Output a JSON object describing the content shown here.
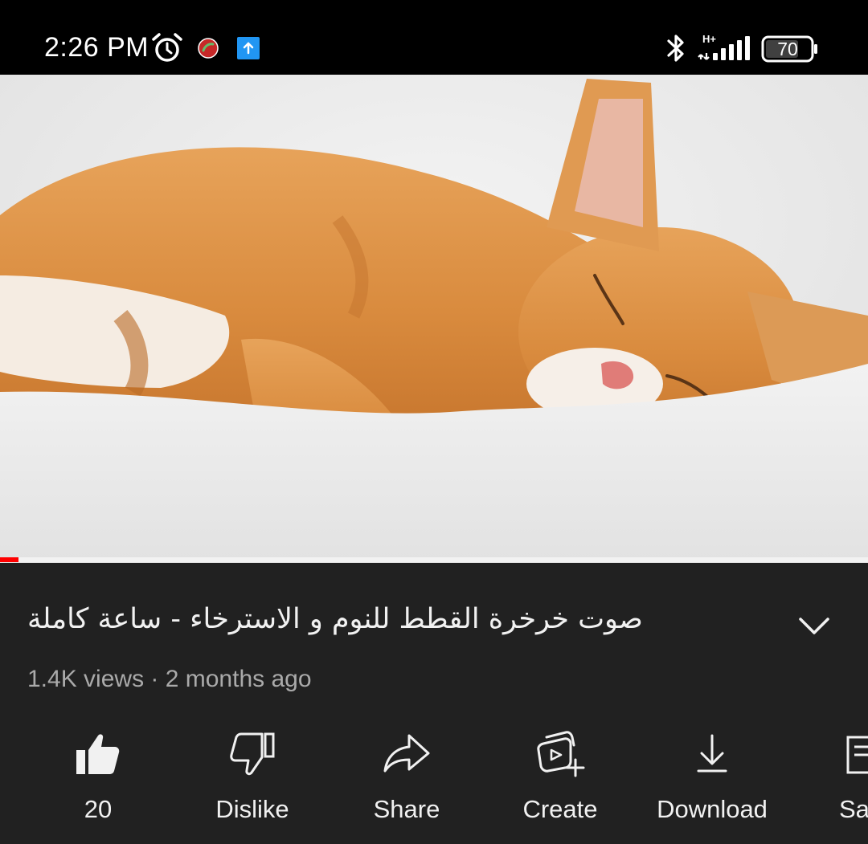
{
  "status_bar": {
    "time": "2:26 PM",
    "network_type": "H+",
    "battery_level": "70",
    "icons": [
      "alarm-icon",
      "call-recorder-icon",
      "upload-icon",
      "bluetooth-icon",
      "signal-icon",
      "battery-icon"
    ]
  },
  "video": {
    "progress": 0.005,
    "progress_color": "#ff0000"
  },
  "details": {
    "title": "صوت خرخرة القطط للنوم و الاسترخاء - ساعة كاملة",
    "meta": "1.4K views · 2 months ago"
  },
  "actions": {
    "like_count": "20",
    "dislike": "Dislike",
    "share": "Share",
    "create": "Create",
    "download": "Download",
    "save": "Save"
  }
}
